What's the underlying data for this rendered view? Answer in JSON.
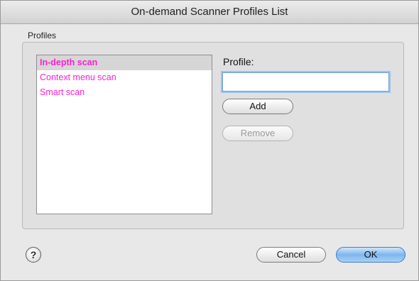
{
  "window": {
    "title": "On-demand Scanner Profiles List"
  },
  "profiles_group": {
    "label": "Profiles",
    "items": [
      {
        "label": "In-depth scan",
        "selected": true
      },
      {
        "label": "Context menu scan",
        "selected": false
      },
      {
        "label": "Smart scan",
        "selected": false
      }
    ],
    "item_color": "#ff1ed2"
  },
  "profile_field": {
    "label": "Profile:",
    "value": ""
  },
  "buttons": {
    "add": "Add",
    "remove": "Remove",
    "cancel": "Cancel",
    "ok": "OK",
    "help": "?"
  }
}
